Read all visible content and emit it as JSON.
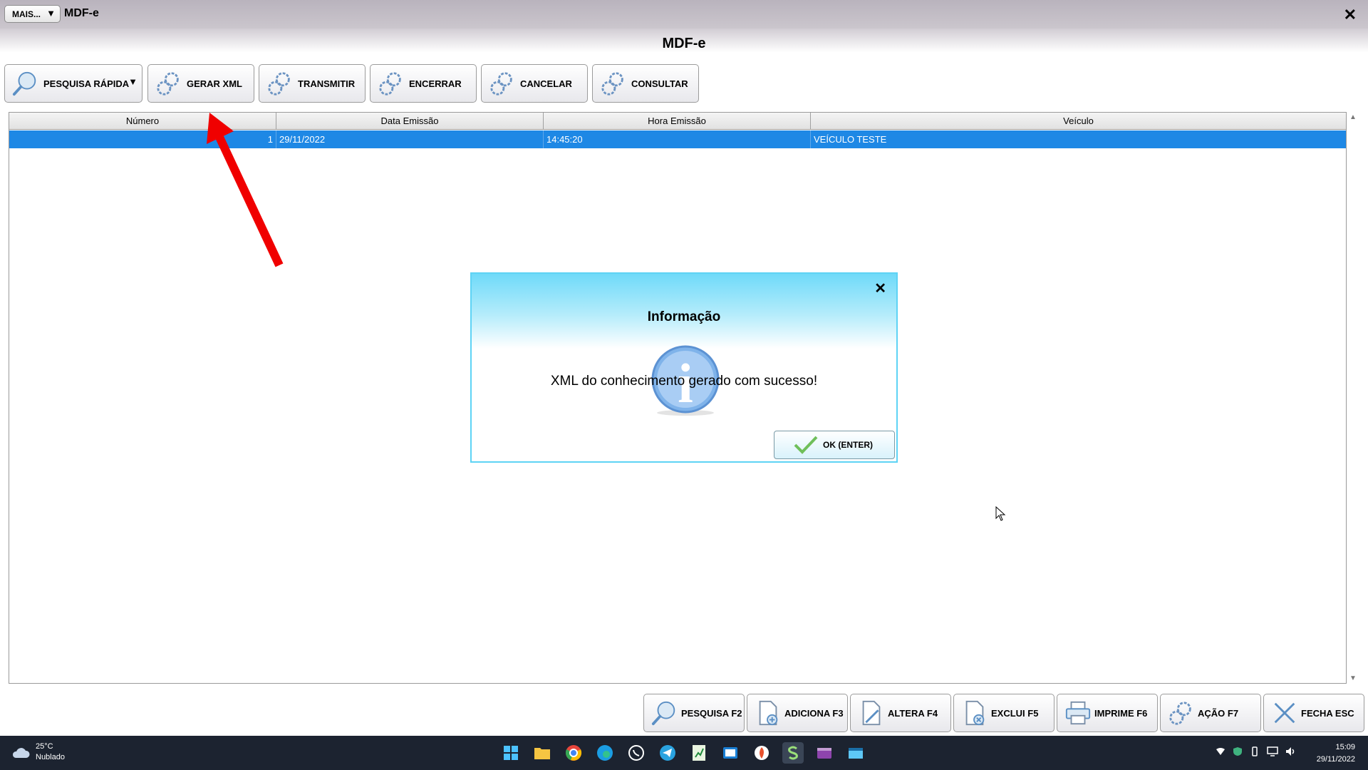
{
  "window": {
    "more_label": "MAIS...",
    "more_caret": "▼",
    "app_title": "MDF-e",
    "close_glyph": "✕"
  },
  "page": {
    "title": "MDF-e"
  },
  "toolbar": {
    "pesquisa_rapida": "PESQUISA RÁPIDA",
    "pesquisa_caret": "▼",
    "gerar_xml": "GERAR XML",
    "transmitir": "TRANSMITIR",
    "encerrar": "ENCERRAR",
    "cancelar": "CANCELAR",
    "consultar": "CONSULTAR"
  },
  "grid": {
    "columns": [
      "Número",
      "Data Emissão",
      "Hora Emissão",
      "Veículo"
    ],
    "rows": [
      {
        "numero": "1",
        "data": "29/11/2022",
        "hora": "14:45:20",
        "veiculo": "VEÍCULO TESTE"
      }
    ],
    "scroll_up": "▲",
    "scroll_down": "▼"
  },
  "dialog": {
    "title": "Informação",
    "message": "XML do conhecimento gerado com sucesso!",
    "ok_label": "OK (ENTER)",
    "close_glyph": "✕",
    "info_glyph": "i"
  },
  "bottom": {
    "pesquisa": "PESQUISA F2",
    "adiciona": "ADICIONA F3",
    "altera": "ALTERA F4",
    "exclui": "EXCLUI F5",
    "imprime": "IMPRIME F6",
    "acao": "AÇÃO F7",
    "fecha": "FECHA ESC"
  },
  "taskbar": {
    "temperature": "25°C",
    "condition": "Nublado",
    "time": "15:09",
    "date": "29/11/2022",
    "apps": [
      "windows-start-icon",
      "file-explorer-icon",
      "chrome-icon",
      "edge-icon",
      "whatsapp-icon",
      "telegram-icon",
      "spreadsheet-icon",
      "mail-icon",
      "app-icon",
      "erp-app-icon",
      "video-icon",
      "window-icon"
    ]
  },
  "colors": {
    "selection": "#1e88e5",
    "dialog_accent": "#5ed3f5",
    "annotation_arrow": "#f00000"
  }
}
